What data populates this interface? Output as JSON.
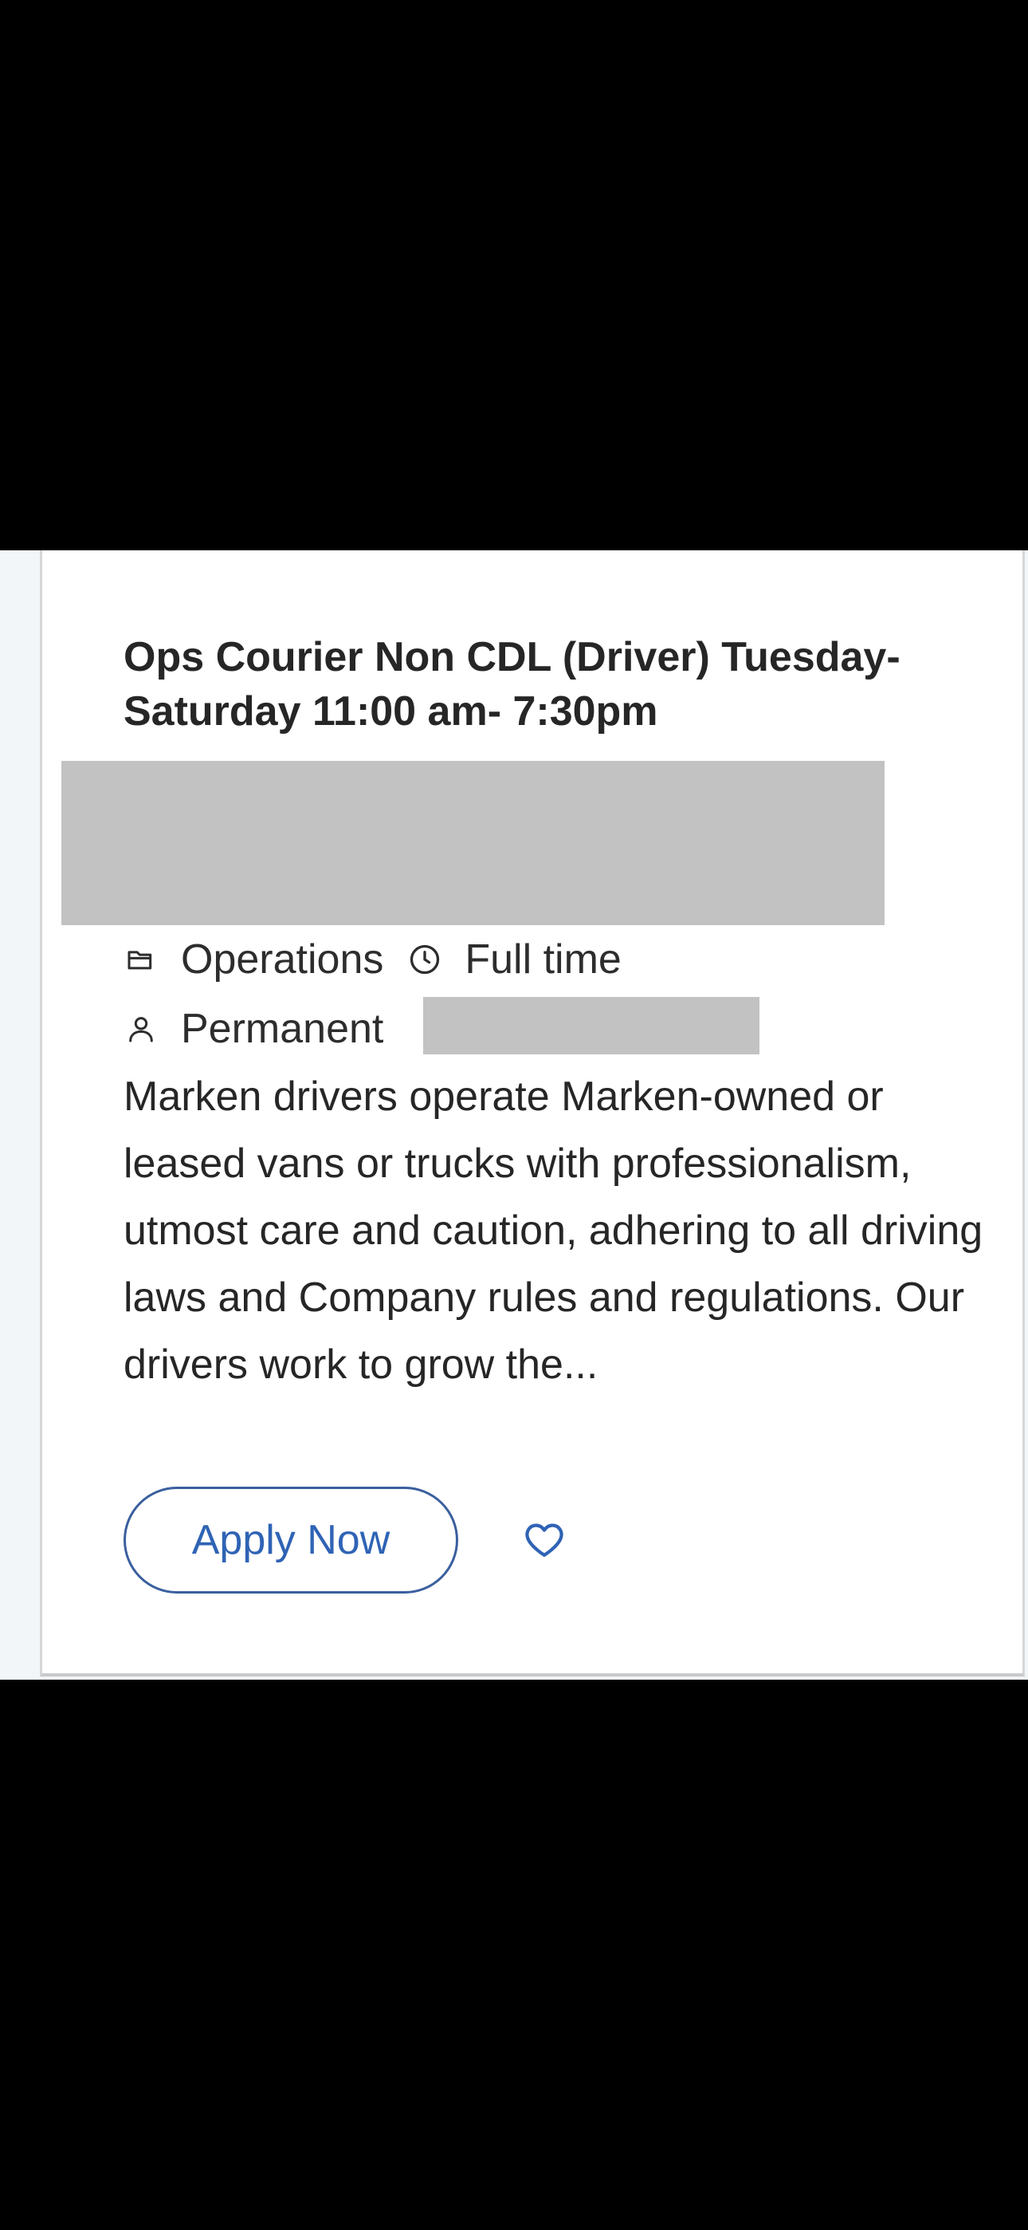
{
  "job": {
    "title": "Ops Courier Non CDL (Driver) Tuesday-Saturday 11:00 am- 7:30pm",
    "category": "Operations",
    "schedule": "Full time",
    "employment_type": "Permanent",
    "description": "Marken drivers operate Marken-owned or leased vans or trucks with professionalism, utmost care and caution, adhering to all driving laws and Company rules and regulations. Our drivers work to grow the..."
  },
  "actions": {
    "apply_label": "Apply Now"
  },
  "icons": {
    "category": "folder-icon",
    "schedule": "clock-icon",
    "employment_type": "person-icon",
    "favorite": "heart-icon"
  },
  "colors": {
    "accent": "#2f63b5",
    "button_border": "#3a5f9e",
    "redaction": "#c2c2c2",
    "text": "#262626"
  }
}
